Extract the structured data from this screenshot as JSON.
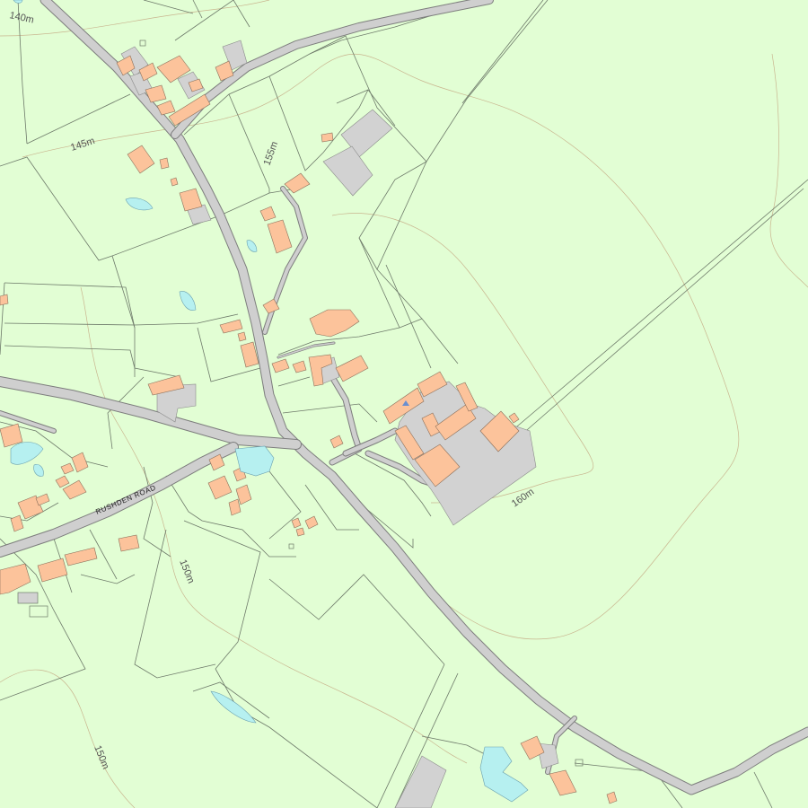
{
  "colors": {
    "land": "#e2fed4",
    "building": "#fcc39b",
    "yard": "#d2d2d2",
    "water": "#b6f0f0",
    "road": "#cfcfcf",
    "road_edge": "#7d7d7d",
    "contour": "#c9b58f",
    "boundary": "#6e7a6a"
  },
  "labels": {
    "contour_140": "140m",
    "contour_145": "145m",
    "contour_155": "155m",
    "contour_150_a": "150m",
    "contour_150_b": "150m",
    "contour_160": "160m",
    "road_rushden": "RUSHDEN ROAD"
  }
}
